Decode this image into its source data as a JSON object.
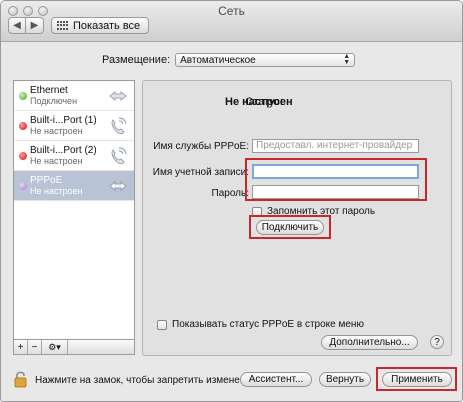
{
  "window": {
    "title": "Сеть"
  },
  "toolbar": {
    "back": "◀",
    "forward": "▶",
    "show_all": "Показать все"
  },
  "location": {
    "label": "Размещение:",
    "value": "Автоматическое"
  },
  "services": [
    {
      "name": "Ethernet",
      "status": "Подключен",
      "dot": "green",
      "icon": "ethernet-arrows-icon"
    },
    {
      "name": "Built-i...Port (1)",
      "status": "Не настроен",
      "dot": "red",
      "icon": "phone-icon"
    },
    {
      "name": "Built-i...Port (2)",
      "status": "Не настроен",
      "dot": "red",
      "icon": "phone-icon"
    },
    {
      "name": "PPPoE",
      "status": "Не настроен",
      "dot": "purple",
      "icon": "ethernet-arrows-icon"
    }
  ],
  "sidebar_tools": {
    "add": "+",
    "remove": "−",
    "gear": "⚙▾"
  },
  "panel": {
    "status_label": "Статус:",
    "status_value": "Не настроен",
    "service_name_label": "Имя службы PPPoE:",
    "service_name_placeholder": "Предоставл. интернет-провайдер",
    "account_label": "Имя учетной записи:",
    "account_value": "",
    "password_label": "Пароль:",
    "password_value": "",
    "remember_label": "Запомнить этот пароль",
    "connect_button": "Подключить",
    "show_status_label": "Показывать статус PPPoE в строке меню",
    "advanced_button": "Дополнительно...",
    "help": "?"
  },
  "footer": {
    "lock_text": "Нажмите на замок, чтобы запретить изменения.",
    "assistant_button": "Ассистент...",
    "revert_button": "Вернуть",
    "apply_button": "Применить"
  },
  "colors": {
    "highlight": "#c8282d",
    "selected_row": "#b8c3d6",
    "focus_ring": "#7ea6dd"
  }
}
